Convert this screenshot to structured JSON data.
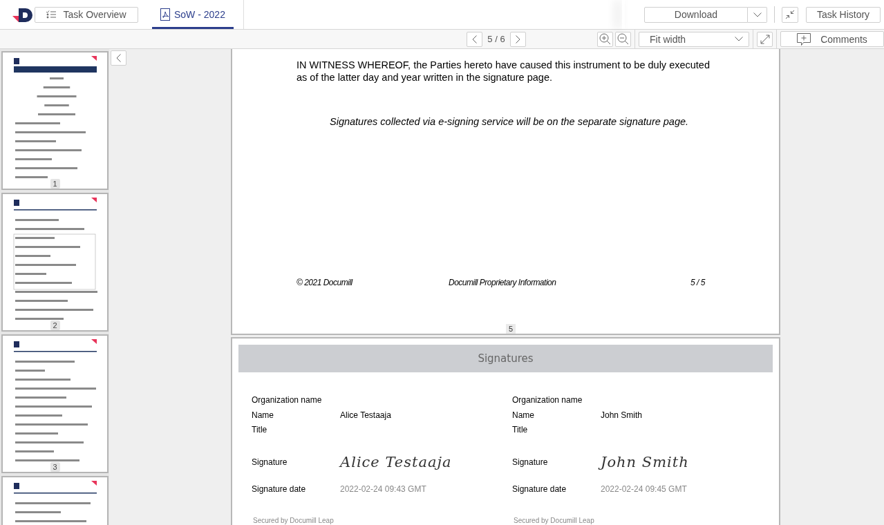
{
  "header": {
    "task_overview": "Task Overview",
    "tabs": [
      {
        "label": "SoW - 2022",
        "selected": true
      }
    ],
    "download": "Download",
    "task_history": "Task History"
  },
  "toolbar": {
    "page_indicator": "5 / 6",
    "zoom_mode": "Fit width",
    "comments": "Comments"
  },
  "thumbnails": [
    {
      "kind": "picture",
      "page": "1"
    },
    {
      "kind": "picture",
      "page": "2"
    },
    {
      "kind": "picture",
      "page": "3"
    },
    {
      "kind": "picture"
    }
  ],
  "pages": [
    {
      "kind": "text",
      "paragraphs": [
        "IN WITNESS WHEREOF, the Parties hereto have caused this instrument to be duly executed as of the latter day and year written in the signature page."
      ],
      "note": "Signatures collected via e-signing service will be on the separate signature page.",
      "footer": [
        "© 2021 Documill",
        "Documill Proprietary Information",
        "5 / 5"
      ],
      "page_number": "5"
    },
    {
      "kind": "signatures",
      "heading": "Signatures",
      "signers": [
        {
          "org_label": "Organization name",
          "name_label": "Name",
          "name": "Alice Testaaja",
          "title_label": "Title",
          "signature_label": "Signature",
          "signature": "Alice Testaaja",
          "date_label": "Signature date",
          "date": "2022-02-24 09:43 GMT",
          "secured": "Secured by Documill Leap"
        },
        {
          "org_label": "Organization name",
          "name_label": "Name",
          "name": "John Smith",
          "title_label": "Title",
          "signature_label": "Signature",
          "signature": "John Smith",
          "date_label": "Signature date",
          "date": "2022-02-24 09:45 GMT",
          "secured": "Secured by Documill Leap"
        }
      ]
    }
  ]
}
